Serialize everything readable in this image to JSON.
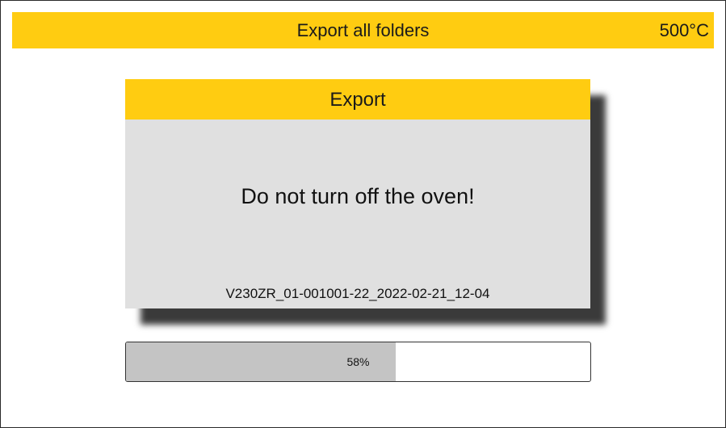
{
  "header": {
    "title": "Export all folders",
    "temperature": "500°C"
  },
  "dialog": {
    "title": "Export",
    "message": "Do not turn off the oven!",
    "filename": "V230ZR_01-001001-22_2022-02-21_12-04"
  },
  "progress": {
    "value": 58,
    "label": "58%"
  },
  "colors": {
    "accent": "#ffcc11",
    "dialog_background": "#e0e0e0",
    "progress_fill": "#c4c4c4"
  }
}
